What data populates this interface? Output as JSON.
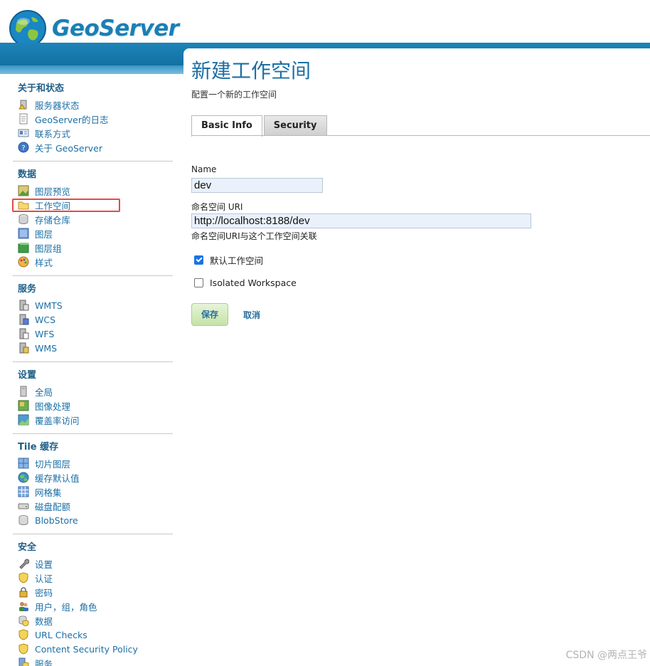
{
  "app": {
    "logo_text": "GeoServer"
  },
  "sidebar": {
    "sections": [
      {
        "heading": "关于和状态",
        "items": [
          {
            "label": "服务器状态",
            "icon": "server-status-icon"
          },
          {
            "label": "GeoServer的日志",
            "icon": "log-document-icon"
          },
          {
            "label": "联系方式",
            "icon": "contact-card-icon"
          },
          {
            "label": "关于 GeoServer",
            "icon": "about-help-icon"
          }
        ]
      },
      {
        "heading": "数据",
        "items": [
          {
            "label": "图层预览",
            "icon": "layer-preview-icon"
          },
          {
            "label": "工作空间",
            "icon": "folder-icon"
          },
          {
            "label": "存储仓库",
            "icon": "store-cylinder-icon"
          },
          {
            "label": "图层",
            "icon": "layer-icon"
          },
          {
            "label": "图层组",
            "icon": "layer-group-icon"
          },
          {
            "label": "样式",
            "icon": "style-palette-icon"
          }
        ]
      },
      {
        "heading": "服务",
        "items": [
          {
            "label": "WMTS",
            "icon": "wmts-service-icon"
          },
          {
            "label": "WCS",
            "icon": "wcs-service-icon"
          },
          {
            "label": "WFS",
            "icon": "wfs-service-icon"
          },
          {
            "label": "WMS",
            "icon": "wms-service-icon"
          }
        ]
      },
      {
        "heading": "设置",
        "items": [
          {
            "label": "全局",
            "icon": "global-settings-icon"
          },
          {
            "label": "图像处理",
            "icon": "image-processing-icon"
          },
          {
            "label": "覆盖率访问",
            "icon": "coverage-access-icon"
          }
        ]
      },
      {
        "heading": "Tile 缓存",
        "items": [
          {
            "label": "切片图层",
            "icon": "tile-layers-icon"
          },
          {
            "label": "缓存默认值",
            "icon": "globe-defaults-icon"
          },
          {
            "label": "网格集",
            "icon": "gridset-icon"
          },
          {
            "label": "磁盘配额",
            "icon": "disk-quota-icon"
          },
          {
            "label": "BlobStore",
            "icon": "blobstore-icon"
          }
        ]
      },
      {
        "heading": "安全",
        "items": [
          {
            "label": "设置",
            "icon": "wrench-icon"
          },
          {
            "label": "认证",
            "icon": "shield-icon"
          },
          {
            "label": "密码",
            "icon": "lock-icon"
          },
          {
            "label": "用户，组，角色",
            "icon": "users-icon"
          },
          {
            "label": "数据",
            "icon": "data-security-icon"
          },
          {
            "label": "URL Checks",
            "icon": "shield-icon"
          },
          {
            "label": "Content Security Policy",
            "icon": "shield-icon"
          },
          {
            "label": "服务",
            "icon": "service-security-icon"
          }
        ]
      }
    ]
  },
  "main": {
    "title": "新建工作空间",
    "description": "配置一个新的工作空间",
    "tabs": [
      {
        "label": "Basic Info",
        "active": true
      },
      {
        "label": "Security",
        "active": false
      }
    ],
    "form": {
      "name_label": "Name",
      "name_value": "dev",
      "uri_label": "命名空间 URI",
      "uri_value": "http://localhost:8188/dev",
      "uri_hint": "命名空间URI与这个工作空间关联",
      "default_label": "默认工作空间",
      "default_checked": true,
      "isolated_label": "Isolated Workspace",
      "isolated_checked": false,
      "save_label": "保存",
      "cancel_label": "取消"
    }
  },
  "watermark": "CSDN @两点王爷",
  "colors": {
    "brand_blue": "#1b7fb4",
    "link_blue": "#1b6fa6",
    "highlight_red": "#e24a4a",
    "save_green": "#c5e3a9"
  }
}
